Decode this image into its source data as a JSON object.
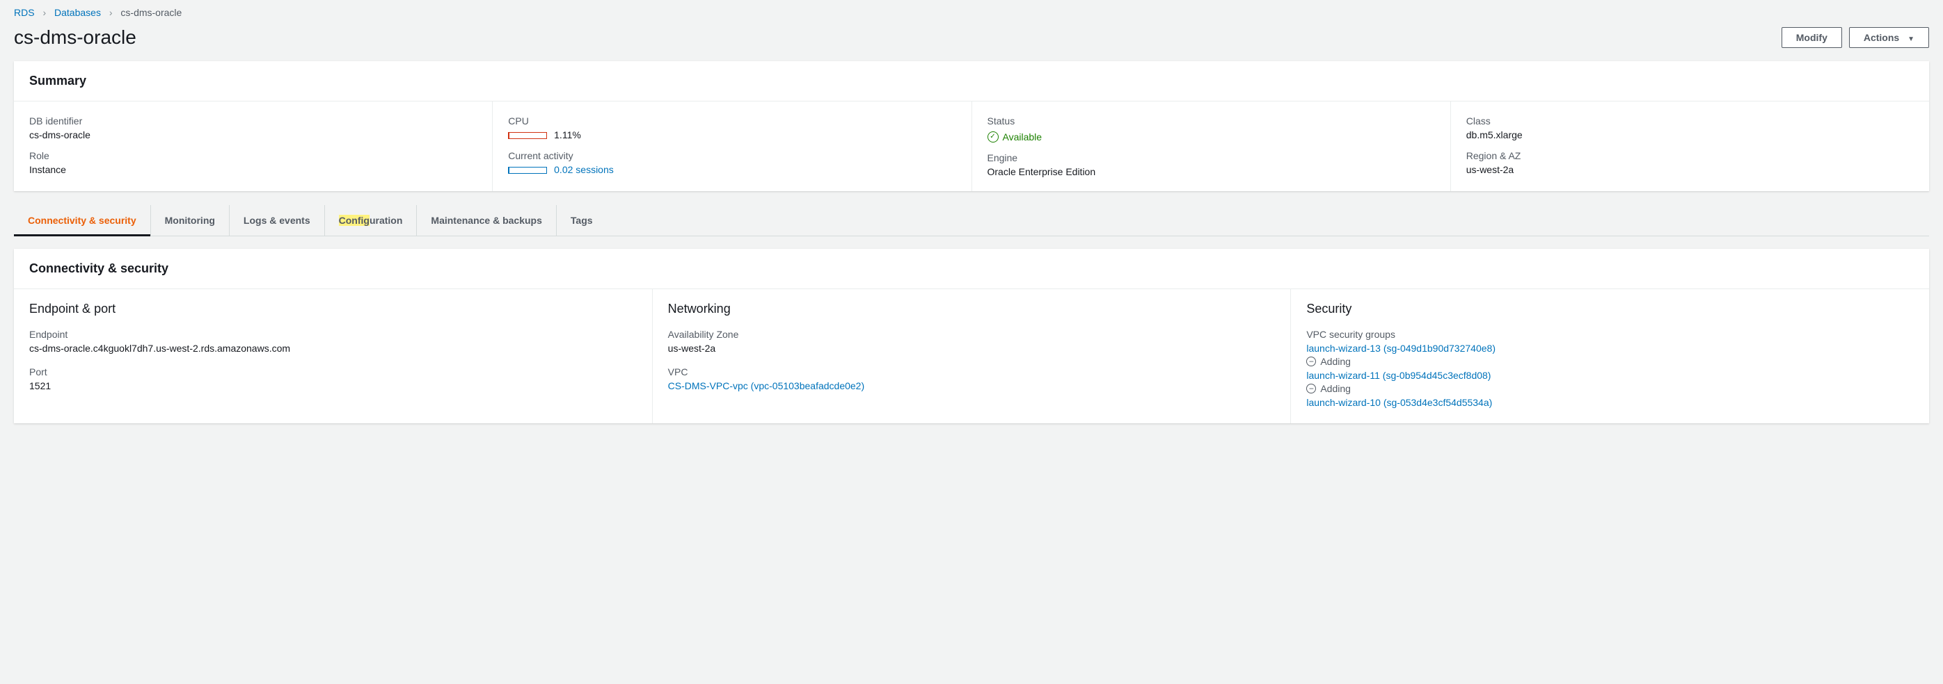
{
  "breadcrumb": {
    "rds": "RDS",
    "databases": "Databases",
    "current": "cs-dms-oracle"
  },
  "pageTitle": "cs-dms-oracle",
  "actions": {
    "modify": "Modify",
    "actions": "Actions"
  },
  "summary": {
    "title": "Summary",
    "col1": {
      "dbIdentifierLabel": "DB identifier",
      "dbIdentifier": "cs-dms-oracle",
      "roleLabel": "Role",
      "role": "Instance"
    },
    "col2": {
      "cpuLabel": "CPU",
      "cpu": "1.11%",
      "currentActivityLabel": "Current activity",
      "currentActivity": "0.02 sessions"
    },
    "col3": {
      "statusLabel": "Status",
      "status": "Available",
      "engineLabel": "Engine",
      "engine": "Oracle Enterprise Edition"
    },
    "col4": {
      "classLabel": "Class",
      "class": "db.m5.xlarge",
      "regionAzLabel": "Region & AZ",
      "regionAz": "us-west-2a"
    }
  },
  "tabs": {
    "connectivity": "Connectivity & security",
    "monitoring": "Monitoring",
    "logs": "Logs & events",
    "configPrefix": "Config",
    "configSuffix": "uration",
    "maintenance": "Maintenance & backups",
    "tags": "Tags"
  },
  "details": {
    "title": "Connectivity & security",
    "endpointPort": {
      "heading": "Endpoint & port",
      "endpointLabel": "Endpoint",
      "endpoint": "cs-dms-oracle.c4kguokl7dh7.us-west-2.rds.amazonaws.com",
      "portLabel": "Port",
      "port": "1521"
    },
    "networking": {
      "heading": "Networking",
      "azLabel": "Availability Zone",
      "az": "us-west-2a",
      "vpcLabel": "VPC",
      "vpc": "CS-DMS-VPC-vpc (vpc-05103beafadcde0e2)"
    },
    "security": {
      "heading": "Security",
      "sgLabel": "VPC security groups",
      "sg1": "launch-wizard-13 (sg-049d1b90d732740e8)",
      "sg2": "launch-wizard-11 (sg-0b954d45c3ecf8d08)",
      "sg3": "launch-wizard-10 (sg-053d4e3cf54d5534a)",
      "adding": "Adding"
    }
  }
}
